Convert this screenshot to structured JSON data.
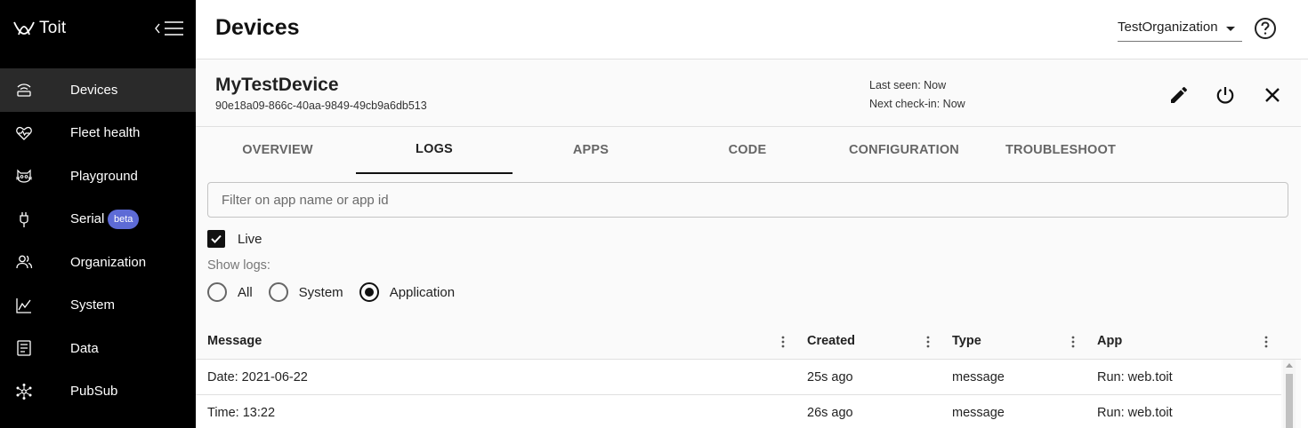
{
  "app": {
    "brand": "Toit"
  },
  "sidebar": {
    "items": [
      {
        "label": "Devices",
        "icon": "router-icon",
        "active": true
      },
      {
        "label": "Fleet health",
        "icon": "heart-pulse-icon"
      },
      {
        "label": "Playground",
        "icon": "cat-face-icon"
      },
      {
        "label": "Serial",
        "icon": "usb-plug-icon",
        "badge": "beta"
      },
      {
        "label": "Organization",
        "icon": "people-icon"
      },
      {
        "label": "System",
        "icon": "line-chart-icon"
      },
      {
        "label": "Data",
        "icon": "document-list-icon"
      },
      {
        "label": "PubSub",
        "icon": "hub-nodes-icon"
      }
    ]
  },
  "header": {
    "title": "Devices",
    "organization": "TestOrganization"
  },
  "device": {
    "name": "MyTestDevice",
    "id": "90e18a09-866c-40aa-9849-49cb9a6db513",
    "last_seen": "Last seen: Now",
    "next_checkin": "Next check-in: Now"
  },
  "tabs": [
    "OVERVIEW",
    "LOGS",
    "APPS",
    "CODE",
    "CONFIGURATION",
    "TROUBLESHOOT"
  ],
  "active_tab": "LOGS",
  "filter": {
    "placeholder": "Filter on app name or app id",
    "value": ""
  },
  "live": {
    "label": "Live",
    "checked": true
  },
  "show_logs": {
    "label": "Show logs:",
    "options": [
      "All",
      "System",
      "Application"
    ],
    "selected": "Application"
  },
  "table": {
    "columns": [
      "Message",
      "Created",
      "Type",
      "App"
    ],
    "rows": [
      {
        "message": "Date: 2021-06-22",
        "created": "25s ago",
        "type": "message",
        "app": "Run: web.toit"
      },
      {
        "message": "Time: 13:22",
        "created": "26s ago",
        "type": "message",
        "app": "Run: web.toit"
      }
    ]
  },
  "colors": {
    "sidebar_bg": "#000000",
    "active_item_bg": "#2a2a2a",
    "beta_badge": "#5d6bd6",
    "panel_bg": "#fafafa"
  }
}
